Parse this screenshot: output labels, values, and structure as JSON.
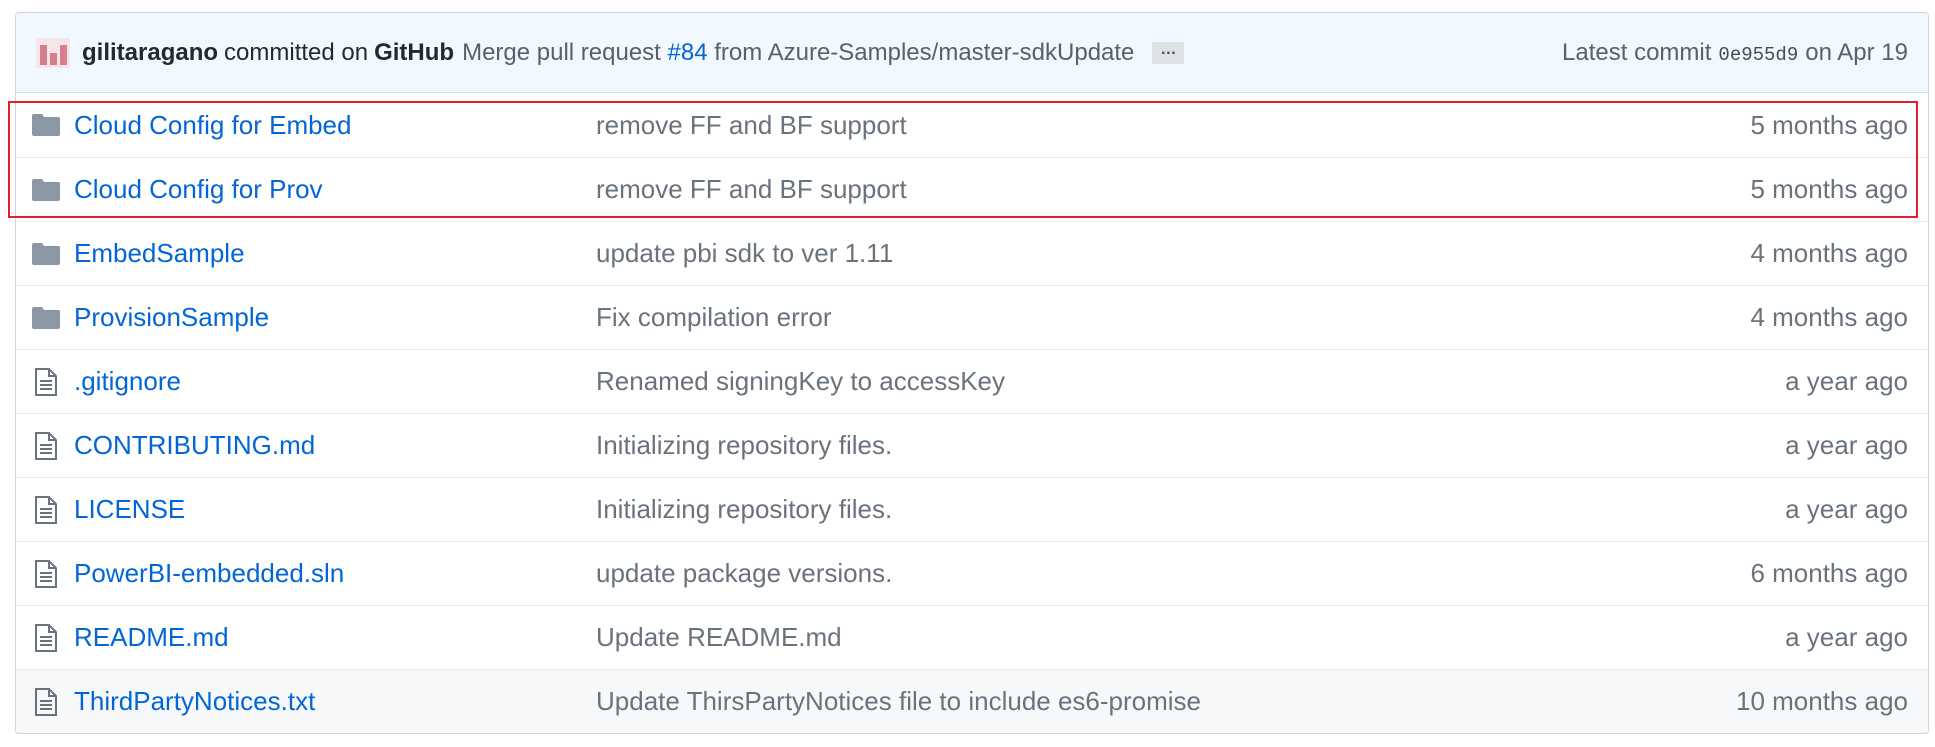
{
  "commit": {
    "author": "gilitaragano",
    "committed_on": "committed on",
    "platform": "GitHub",
    "message_prefix": "Merge pull request",
    "pr_number": "#84",
    "message_suffix": "from Azure-Samples/master-sdkUpdate",
    "ellipsis": "…",
    "latest_label": "Latest commit",
    "sha": "0e955d9",
    "date": "on Apr 19"
  },
  "files": [
    {
      "type": "folder",
      "icon": "folder-icon",
      "name": "Cloud Config for Embed",
      "message": "remove FF and BF support",
      "age": "5 months ago"
    },
    {
      "type": "folder",
      "icon": "folder-icon",
      "name": "Cloud Config for Prov",
      "message": "remove FF and BF support",
      "age": "5 months ago"
    },
    {
      "type": "folder",
      "icon": "folder-icon",
      "name": "EmbedSample",
      "message": "update pbi sdk to ver 1.11",
      "age": "4 months ago"
    },
    {
      "type": "folder",
      "icon": "folder-icon",
      "name": "ProvisionSample",
      "message": "Fix compilation error",
      "age": "4 months ago"
    },
    {
      "type": "file",
      "icon": "file-icon",
      "name": ".gitignore",
      "message": "Renamed signingKey to accessKey",
      "age": "a year ago"
    },
    {
      "type": "file",
      "icon": "file-icon",
      "name": "CONTRIBUTING.md",
      "message": "Initializing repository files.",
      "age": "a year ago"
    },
    {
      "type": "file",
      "icon": "file-icon",
      "name": "LICENSE",
      "message": "Initializing repository files.",
      "age": "a year ago"
    },
    {
      "type": "file",
      "icon": "file-icon",
      "name": "PowerBI-embedded.sln",
      "message": "update package versions.",
      "age": "6 months ago"
    },
    {
      "type": "file",
      "icon": "file-icon",
      "name": "README.md",
      "message": "Update README.md",
      "age": "a year ago"
    },
    {
      "type": "file",
      "icon": "file-icon",
      "name": "ThirdPartyNotices.txt",
      "message": "Update ThirsPartyNotices file to include es6-promise",
      "age": "10 months ago"
    }
  ],
  "colors": {
    "link": "#0366d6",
    "folder_icon": "#79b8ff",
    "highlight": "#e0202a"
  }
}
